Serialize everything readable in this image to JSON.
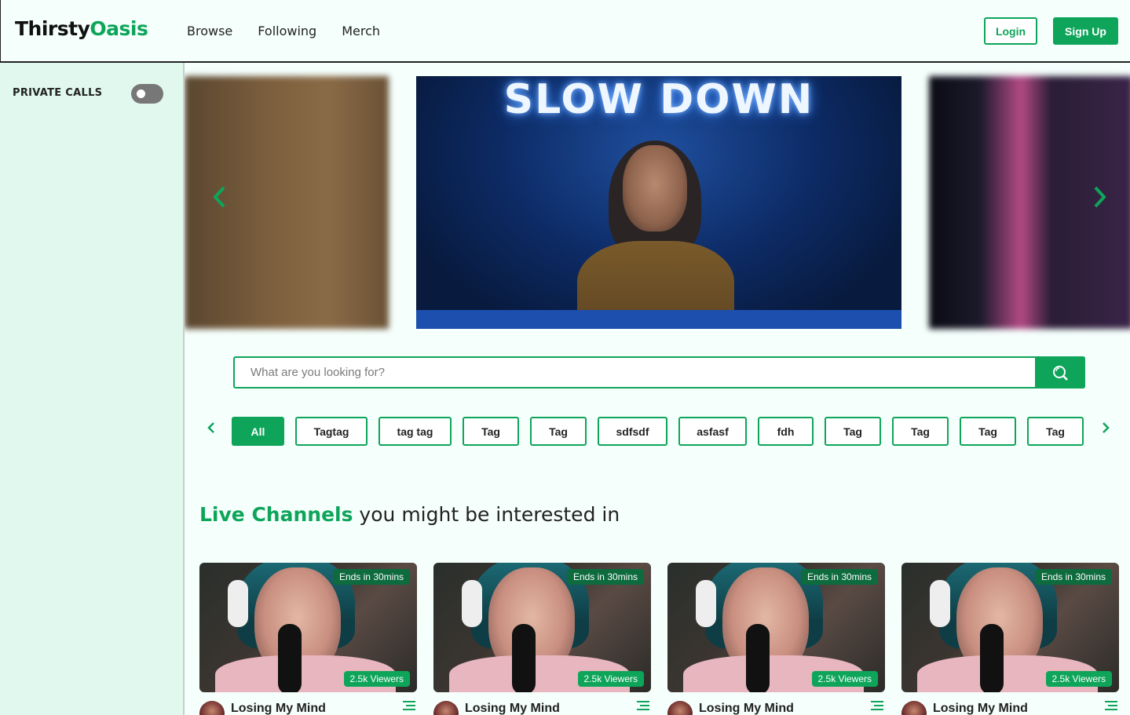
{
  "header": {
    "logo_part1": "Thirsty",
    "logo_part2": "Oasis",
    "nav": [
      "Browse",
      "Following",
      "Merch"
    ],
    "login_label": "Login",
    "signup_label": "Sign Up"
  },
  "sidebar": {
    "private_calls_label": "PRIVATE CALLS",
    "private_calls_enabled": false
  },
  "carousel": {
    "center_sign_text": "SLOW DOWN"
  },
  "search": {
    "placeholder": "What are you looking for?",
    "value": ""
  },
  "tags": [
    "All",
    "Tagtag",
    "tag tag",
    "Tag",
    "Tag",
    "sdfsdf",
    "asfasf",
    "fdh",
    "Tag",
    "Tag",
    "Tag",
    "Tag"
  ],
  "active_tag_index": 0,
  "section": {
    "title_highlight": "Live Channels",
    "title_rest": " you might be interested in"
  },
  "channels": [
    {
      "title": "Losing My Mind",
      "ends": "Ends in 30mins",
      "viewers": "2.5k Viewers"
    },
    {
      "title": "Losing My Mind",
      "ends": "Ends in 30mins",
      "viewers": "2.5k Viewers"
    },
    {
      "title": "Losing My Mind",
      "ends": "Ends in 30mins",
      "viewers": "2.5k Viewers"
    },
    {
      "title": "Losing My Mind",
      "ends": "Ends in 30mins",
      "viewers": "2.5k Viewers"
    }
  ],
  "colors": {
    "accent": "#0ea55a",
    "sidebar_bg": "#e0f8ee",
    "page_bg": "#f5fffc"
  },
  "icons": {
    "search": "search-icon",
    "carousel_prev": "chevron-left-icon",
    "carousel_next": "chevron-right-icon",
    "card_menu": "menu-icon"
  }
}
